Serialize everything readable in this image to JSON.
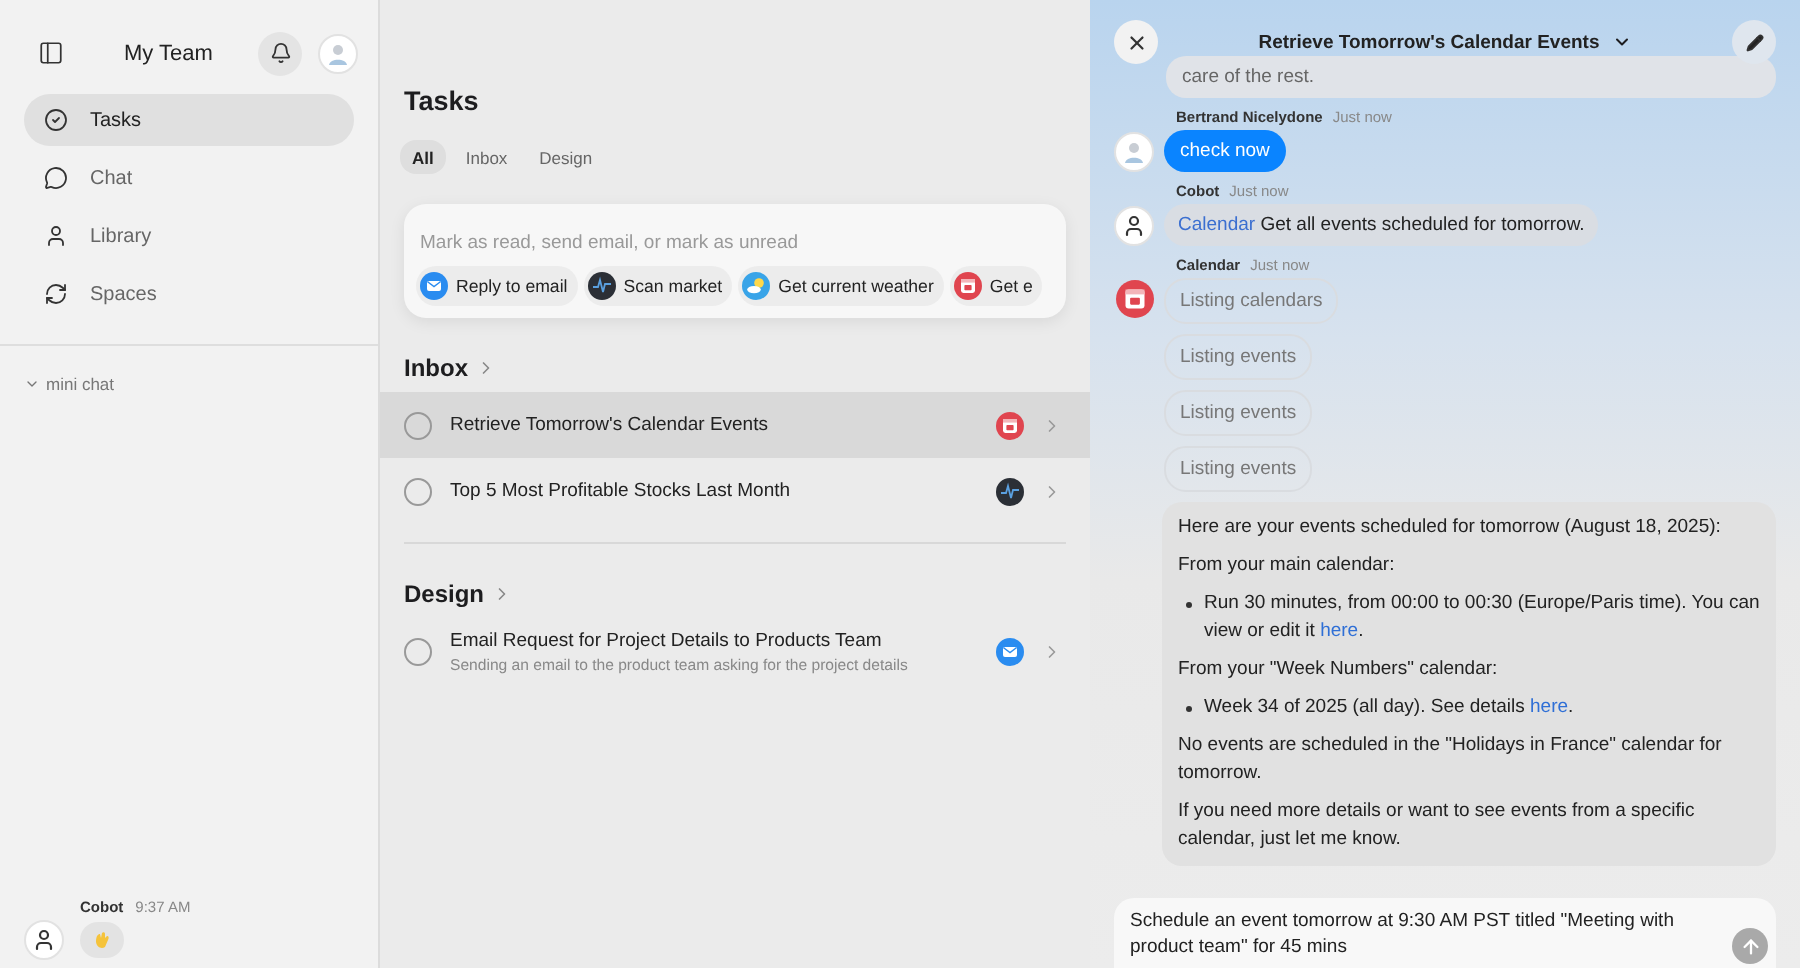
{
  "sidebar": {
    "title": "My Team",
    "nav": [
      {
        "label": "Tasks",
        "selected": true
      },
      {
        "label": "Chat",
        "selected": false
      },
      {
        "label": "Library",
        "selected": false
      },
      {
        "label": "Spaces",
        "selected": false
      }
    ],
    "section": {
      "label": "mini chat",
      "expanded": true
    },
    "last_message": {
      "sender": "Cobot",
      "time": "9:37 AM"
    }
  },
  "tasks": {
    "title": "Tasks",
    "filters": [
      {
        "label": "All",
        "selected": true
      },
      {
        "label": "Inbox",
        "selected": false
      },
      {
        "label": "Design",
        "selected": false
      }
    ],
    "command": {
      "placeholder": "Mark as read, send email, or mark as unread",
      "suggestions": [
        {
          "kind": "mail",
          "label": "Reply to email"
        },
        {
          "kind": "market",
          "label": "Scan market"
        },
        {
          "kind": "weather",
          "label": "Get current weather"
        },
        {
          "kind": "calendar",
          "label": "Get e"
        }
      ]
    },
    "groups": [
      {
        "name": "Inbox",
        "items": [
          {
            "title": "Retrieve Tomorrow's Calendar Events",
            "kind": "calendar",
            "selected": true,
            "checked": false
          },
          {
            "title": "Top 5 Most Profitable Stocks Last Month",
            "kind": "market",
            "selected": false,
            "checked": false
          }
        ]
      },
      {
        "name": "Design",
        "items": [
          {
            "title": "Email Request for Project Details to Products Team",
            "subtitle": "Sending an email to the product team asking for the project details",
            "kind": "mail",
            "selected": false,
            "checked": false
          }
        ]
      }
    ]
  },
  "chat": {
    "title": "Retrieve Tomorrow's Calendar Events",
    "messages": [
      {
        "kind": "text",
        "text": "care of the rest."
      },
      {
        "kind": "user",
        "sender": "Bertrand Nicelydone",
        "time": "Just now",
        "avatar": {
          "kind": "user"
        },
        "text": "check now"
      },
      {
        "kind": "tool",
        "sender": "Cobot",
        "time": "Just now",
        "avatar": {
          "kind": "bot"
        },
        "tool": "Calendar",
        "text": "Get all events scheduled for tomorrow."
      },
      {
        "kind": "status",
        "sender": "Calendar",
        "time": "Just now",
        "avatar": {
          "kind": "calendar"
        },
        "steps": [
          "Listing calendars",
          "Listing events",
          "Listing events",
          "Listing events"
        ]
      },
      {
        "kind": "rich",
        "blocks": [
          {
            "kind": "paragraph",
            "text": "Here are your events scheduled for tomorrow (August 18, 2025):"
          },
          {
            "kind": "paragraph",
            "text": "From your main calendar:"
          },
          {
            "kind": "bullet",
            "text": "Run 30 minutes, from 00:00 to 00:30 (Europe/Paris time). You can view or edit it",
            "link": "here",
            "after": "."
          },
          {
            "kind": "paragraph",
            "text": "From your \"Week Numbers\" calendar:"
          },
          {
            "kind": "bullet",
            "text": "Week 34 of 2025 (all day). See details",
            "link": "here",
            "after": "."
          },
          {
            "kind": "paragraph",
            "text": "No events are scheduled in the \"Holidays in France\" calendar for tomorrow."
          },
          {
            "kind": "paragraph",
            "text": "If you need more details or want to see events from a specific calendar, just let me know."
          }
        ]
      }
    ],
    "composer": {
      "value": "Schedule an event tomorrow at 9:30 AM PST titled \"Meeting with product team\" for 45 mins"
    }
  }
}
